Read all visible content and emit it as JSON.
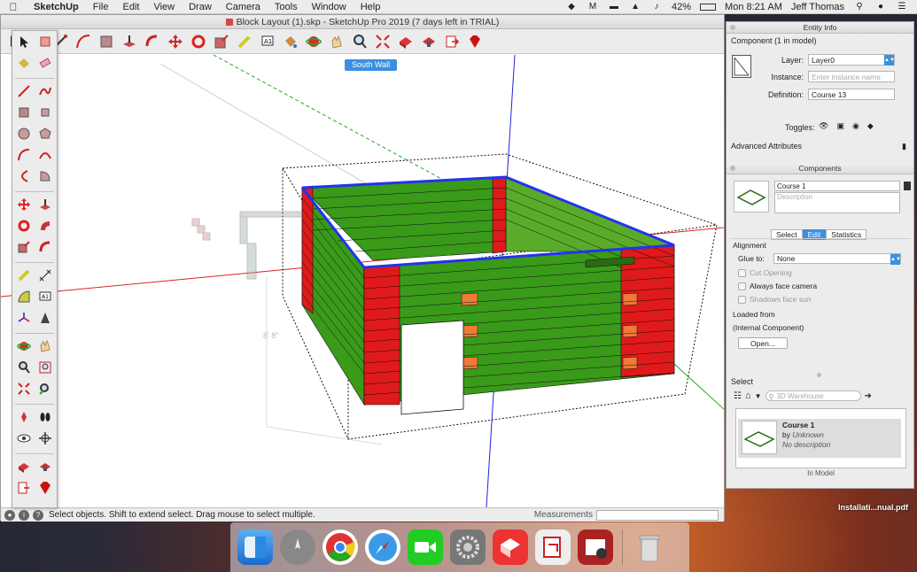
{
  "menubar": {
    "app": "SketchUp",
    "items": [
      "File",
      "Edit",
      "View",
      "Draw",
      "Camera",
      "Tools",
      "Window",
      "Help"
    ],
    "battery": "42%",
    "clock": "Mon 8:21 AM",
    "user": "Jeff Thomas"
  },
  "window": {
    "title": "Block Layout (1).skp - SketchUp Pro 2019 (7 days left in TRIAL)",
    "scene_tab": "South Wall",
    "dimension_label": "8' 8\"",
    "status_message": "Select objects. Shift to extend select. Drag mouse to select multiple.",
    "measurements_label": "Measurements"
  },
  "toolbar_icons": [
    "select-icon",
    "eraser-icon",
    "line-icon",
    "arc-icon",
    "rectangle-icon",
    "push-pull-icon",
    "offset-icon",
    "move-icon",
    "rotate-icon",
    "scale-icon",
    "tape-measure-icon",
    "text-icon",
    "paint-bucket-icon",
    "orbit-icon",
    "pan-icon",
    "zoom-icon",
    "zoom-extents-icon",
    "warehouse-icon",
    "extension-warehouse-icon",
    "layout-icon",
    "ruby-icon"
  ],
  "entity_info": {
    "panel_title": "Entity Info",
    "component_title": "Component (1 in model)",
    "layer_label": "Layer:",
    "layer_value": "Layer0",
    "instance_label": "Instance:",
    "instance_placeholder": "Enter instance name",
    "definition_label": "Definition:",
    "definition_value": "Course 13",
    "toggles_label": "Toggles:",
    "advanced_label": "Advanced Attributes"
  },
  "components": {
    "panel_title": "Components",
    "name_value": "Course 1",
    "description_placeholder": "Description",
    "tabs": [
      "Select",
      "Edit",
      "Statistics"
    ],
    "active_tab": "Edit",
    "alignment_label": "Alignment",
    "glue_label": "Glue to:",
    "glue_value": "None",
    "cut_opening": "Cut Opening",
    "always_face_camera": "Always face camera",
    "shadows_face_sun": "Shadows face sun",
    "loaded_from_label": "Loaded from",
    "loaded_from_value": "(Internal Component)",
    "open_button": "Open...",
    "select_label": "Select",
    "search_placeholder": "3D Warehouse",
    "item_name": "Course 1",
    "item_by_prefix": "by",
    "item_by": "Unknown",
    "item_desc": "No description",
    "footer": "In Model"
  },
  "desktop_file": "Installati...nual.pdf",
  "colors": {
    "accent": "#3b8fe0",
    "brick_green": "#3a9a1a",
    "brick_red": "#e01a1a",
    "brick_orange": "#f07a3a",
    "axis_red": "#d22",
    "axis_green": "#2a2",
    "axis_blue": "#22d"
  }
}
